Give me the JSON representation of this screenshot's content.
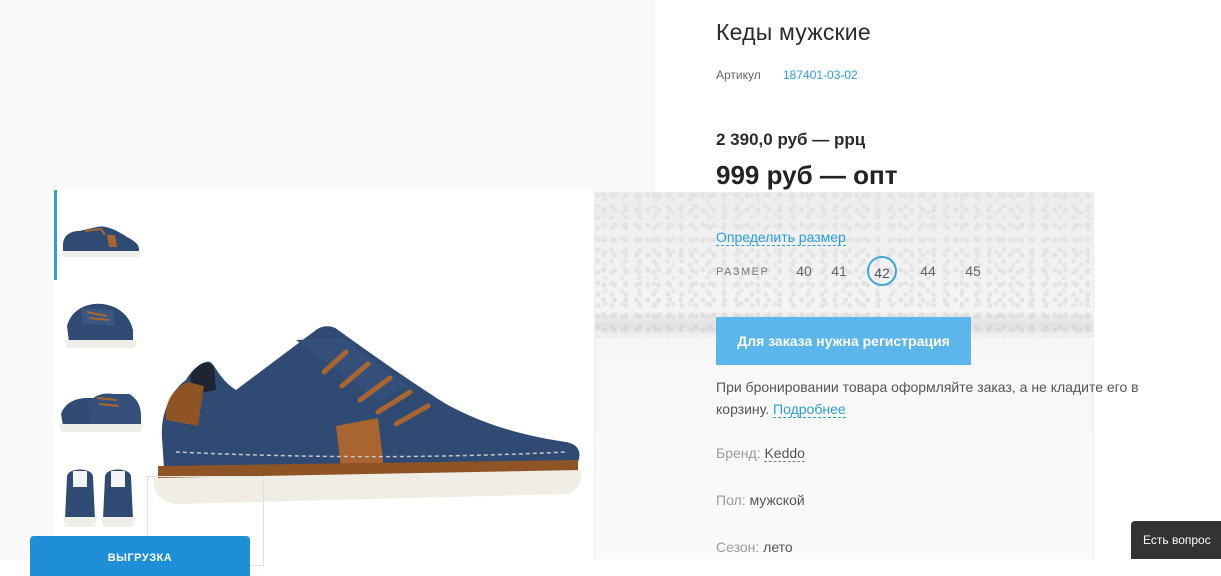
{
  "product": {
    "title": "Кеды мужские",
    "sku_label": "Артикул",
    "sku_value": "187401-03-02",
    "price_rrp": "2 390,0 руб — ррц",
    "price_opt": "999 руб — опт"
  },
  "sizes": {
    "link": "Определить размер",
    "label": "РАЗМЕР",
    "options": [
      "40",
      "41",
      "42",
      "44",
      "45"
    ],
    "selected": "42"
  },
  "order": {
    "button_label": "Для заказа нужна регистрация",
    "note_text": "При бронировании товара оформляйте заказ, а не кладите его в корзину.",
    "note_link": "Подробнее"
  },
  "properties": {
    "brand_label": "Бренд:",
    "brand_value": "Keddo",
    "gender_label": "Пол:",
    "gender_value": "мужской",
    "season_label": "Сезон:",
    "season_value": "лето"
  },
  "gallery": {
    "thumbs": [
      "shoe-side-view",
      "shoe-angle-view",
      "shoe-pair-view",
      "shoe-back-view"
    ],
    "active_index": 0
  },
  "footer": {
    "export_button": "ВЫГРУЗКА",
    "chat_label": "Есть вопрос"
  },
  "colors": {
    "accent": "#2b9fd6",
    "button": "#5bb6ec",
    "denim": "#2f4a73",
    "leather": "#a8652f"
  }
}
